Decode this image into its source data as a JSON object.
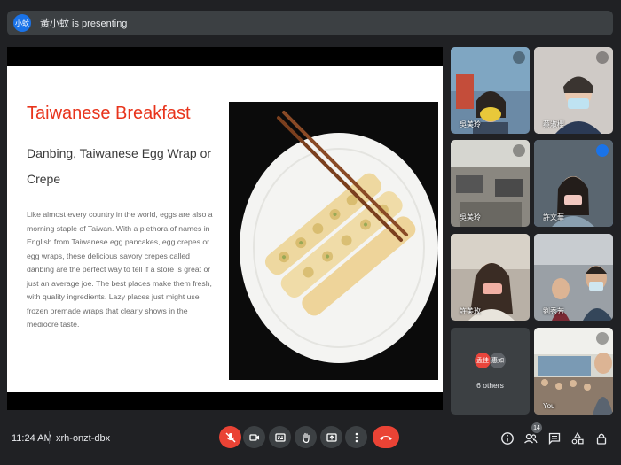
{
  "presenter_bar": {
    "avatar_text": "小蚊",
    "text": "黃小蚊 is presenting"
  },
  "slide": {
    "title": "Taiwanese Breakfast",
    "subtitle": "Danbing, Taiwanese Egg Wrap or Crepe",
    "body": "Like almost every country in the world, eggs are also a morning staple of Taiwan. With a plethora of names in English from Taiwanese egg pancakes, egg crepes or egg wraps, these delicious savory crepes called danbing are the perfect way to tell if a store is great or just an average joe. The best places make them fresh, with quality ingredients. Lazy places just might use frozen premade wraps that clearly shows in the mediocre taste.",
    "colors": {
      "title": "#e8341c",
      "subtitle": "#3a3a3a",
      "body": "#6b6b6b"
    }
  },
  "participants": [
    {
      "name": "吳美玲",
      "mic": "muted",
      "bg": "#6b8aa6"
    },
    {
      "name": "蔡淑櫻",
      "mic": "muted",
      "bg": "#cfcac6"
    },
    {
      "name": "吳美玲",
      "mic": "muted",
      "bg": "#8a8780"
    },
    {
      "name": "許文華",
      "mic": "speaking",
      "bg": "#5a6670"
    },
    {
      "name": "許美玫",
      "mic": "",
      "bg": "#b8b0a6"
    },
    {
      "name": "劉秀芳",
      "mic": "",
      "bg": "#9aa0a6"
    },
    {
      "name": "6 others",
      "mic": "",
      "bg": "#3c4043",
      "avatars": [
        "孟佳",
        "惠如"
      ],
      "avatar_colors": [
        "#e8453c",
        "#5f6368"
      ]
    },
    {
      "name": "You",
      "mic": "muted",
      "bg": "#d9d9d2"
    }
  ],
  "bottom_bar": {
    "time": "11:24 AM",
    "meeting_code": "xrh-onzt-dbx",
    "controls": [
      "mic-off-icon",
      "camera-icon",
      "captions-icon",
      "raise-hand-icon",
      "present-icon",
      "more-icon",
      "end-call-icon"
    ],
    "right_icons": [
      "info-icon",
      "people-icon",
      "chat-icon",
      "activities-icon",
      "lock-icon"
    ],
    "participant_count": "14",
    "colors": {
      "end_call": "#ea4335",
      "muted_button": "#ea4335"
    }
  }
}
